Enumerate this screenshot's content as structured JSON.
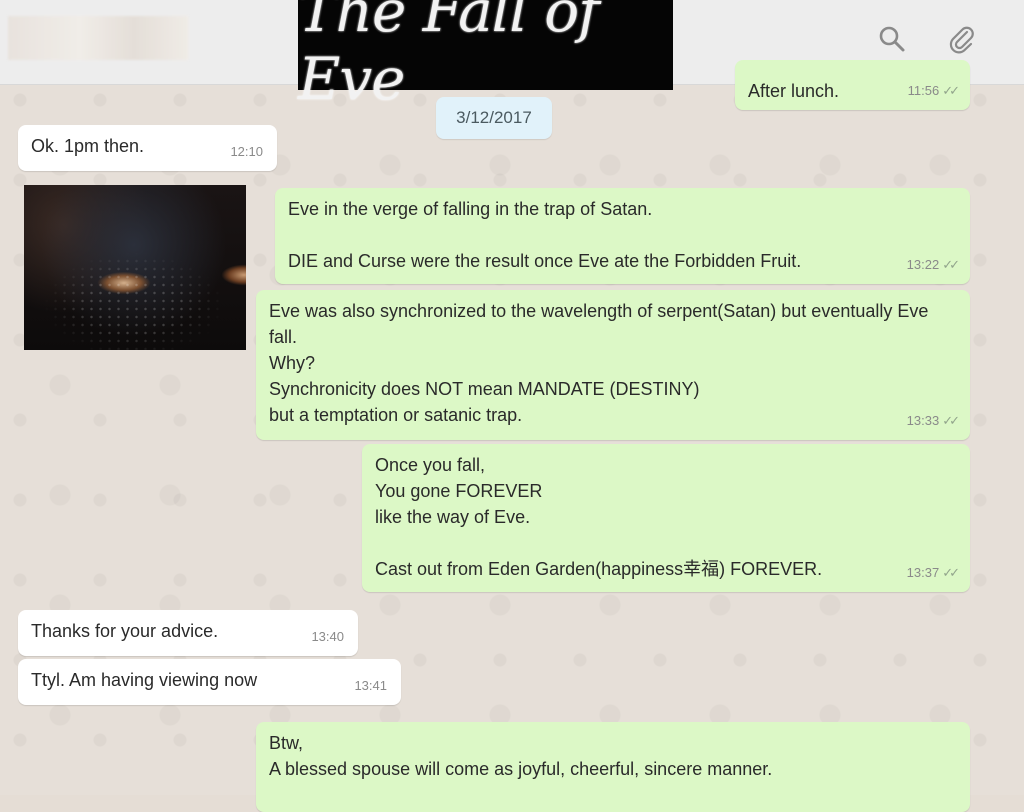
{
  "header": {
    "banner_title": "The Fall of Eve"
  },
  "date_divider": "3/12/2017",
  "messages": [
    {
      "text": "After lunch.",
      "time": "11:56",
      "ticks": "✓✓"
    },
    {
      "text": "Ok. 1pm then.",
      "time": "12:10"
    },
    {
      "text": "Eve in the verge of falling in the trap of Satan.\n\nDIE and Curse were the result once Eve ate the Forbidden Fruit.",
      "time": "13:22",
      "ticks": "✓✓"
    },
    {
      "text": "Eve was also synchronized to the wavelength of serpent(Satan) but eventually Eve fall.\nWhy?\nSynchronicity does NOT mean MANDATE (DESTINY)\nbut a temptation or satanic trap.",
      "time": "13:33",
      "ticks": "✓✓"
    },
    {
      "text": "Once you fall,\nYou gone FOREVER\nlike the way of Eve.\n\nCast out from Eden Garden(happiness幸福) FOREVER.",
      "time": "13:37",
      "ticks": "✓✓"
    },
    {
      "text": "Thanks for your advice.",
      "time": "13:40"
    },
    {
      "text": "Ttyl. Am having viewing now",
      "time": "13:41"
    },
    {
      "text": "Btw,\nA blessed spouse will come as joyful, cheerful, sincere manner."
    }
  ],
  "icons": {
    "search": "search-icon",
    "attach": "paperclip-icon"
  }
}
